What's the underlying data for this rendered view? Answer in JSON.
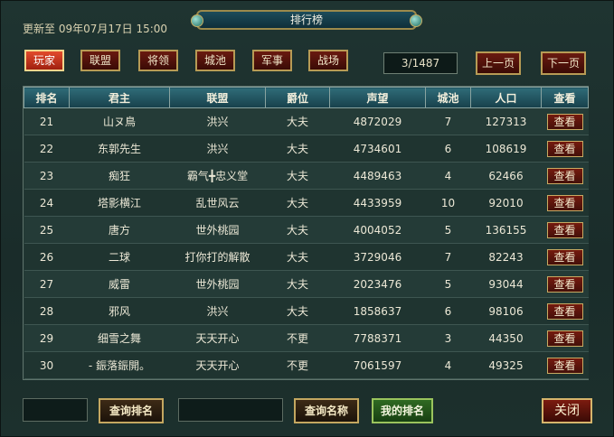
{
  "header": {
    "update_text": "更新至 09年07月17日 15:00",
    "title": "排行榜"
  },
  "tabs": [
    {
      "label": "玩家",
      "active": true
    },
    {
      "label": "联盟",
      "active": false
    },
    {
      "label": "将领",
      "active": false
    },
    {
      "label": "城池",
      "active": false
    },
    {
      "label": "军事",
      "active": false
    },
    {
      "label": "战场",
      "active": false
    }
  ],
  "pagination": {
    "page_text": "3/1487",
    "prev_label": "上一页",
    "next_label": "下一页"
  },
  "table": {
    "columns": [
      "排名",
      "君主",
      "联盟",
      "爵位",
      "声望",
      "城池",
      "人口",
      "查看"
    ],
    "view_label": "查看",
    "rows": [
      {
        "rank": "21",
        "lord": "山ヌ鳥",
        "alliance": "洪兴",
        "title": "大夫",
        "prestige": "4872029",
        "cities": "7",
        "population": "127313"
      },
      {
        "rank": "22",
        "lord": "东郭先生",
        "alliance": "洪兴",
        "title": "大夫",
        "prestige": "4734601",
        "cities": "6",
        "population": "108619"
      },
      {
        "rank": "23",
        "lord": "痴狂",
        "alliance": "霸气╋忠义堂",
        "title": "大夫",
        "prestige": "4489463",
        "cities": "4",
        "population": "62466"
      },
      {
        "rank": "24",
        "lord": "塔影横江",
        "alliance": "乱世风云",
        "title": "大夫",
        "prestige": "4433959",
        "cities": "10",
        "population": "92010"
      },
      {
        "rank": "25",
        "lord": "唐方",
        "alliance": "世外桃园",
        "title": "大夫",
        "prestige": "4004052",
        "cities": "5",
        "population": "136155"
      },
      {
        "rank": "26",
        "lord": "二球",
        "alliance": "打你打的解散",
        "title": "大夫",
        "prestige": "3729046",
        "cities": "7",
        "population": "82243"
      },
      {
        "rank": "27",
        "lord": "威雷",
        "alliance": "世外桃园",
        "title": "大夫",
        "prestige": "2023476",
        "cities": "5",
        "population": "93044"
      },
      {
        "rank": "28",
        "lord": "邪风",
        "alliance": "洪兴",
        "title": "大夫",
        "prestige": "1858637",
        "cities": "6",
        "population": "98106"
      },
      {
        "rank": "29",
        "lord": "细雪之舞",
        "alliance": "天天开心",
        "title": "不更",
        "prestige": "7788371",
        "cities": "3",
        "population": "44350"
      },
      {
        "rank": "30",
        "lord": "- 鋠落鋠開。",
        "alliance": "天天开心",
        "title": "不更",
        "prestige": "7061597",
        "cities": "4",
        "population": "49325"
      }
    ]
  },
  "footer": {
    "rank_input_value": "",
    "query_rank_label": "查询排名",
    "name_input_value": "",
    "query_name_label": "查询名称",
    "my_rank_label": "我的排名",
    "close_label": "关闭"
  }
}
